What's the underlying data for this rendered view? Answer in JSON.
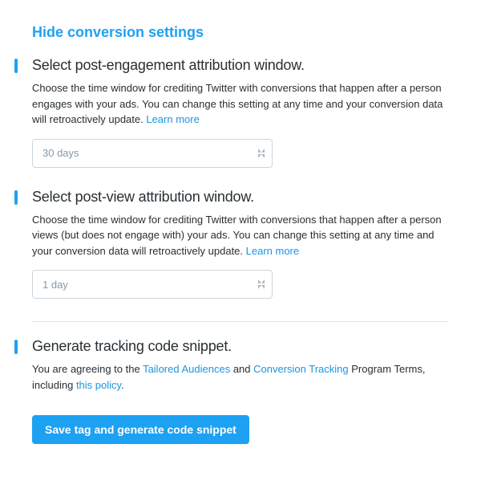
{
  "title": "Hide conversion settings",
  "sections": {
    "postEngagement": {
      "title": "Select post-engagement attribution window.",
      "desc_part1": "Choose the time window for crediting Twitter with conversions that happen after a person engages with your ads. You can change this setting at any time and your conversion data will retroactively update. ",
      "learn_more": "Learn more",
      "select_value": "30 days"
    },
    "postView": {
      "title": "Select post-view attribution window.",
      "desc_part1": "Choose the time window for crediting Twitter with conversions that happen after a person views (but does not engage with) your ads. You can change this setting at any time and your conversion data will retroactively update. ",
      "learn_more": "Learn more",
      "select_value": "1 day"
    },
    "generate": {
      "title": "Generate tracking code snippet.",
      "agree_prefix": "You are agreeing to the ",
      "link1": "Tailored Audiences",
      "and": " and ",
      "link2": "Conversion Tracking",
      "agree_mid": " Program Terms, including ",
      "link3": "this policy",
      "agree_suffix": ".",
      "button": "Save tag and generate code snippet"
    }
  }
}
